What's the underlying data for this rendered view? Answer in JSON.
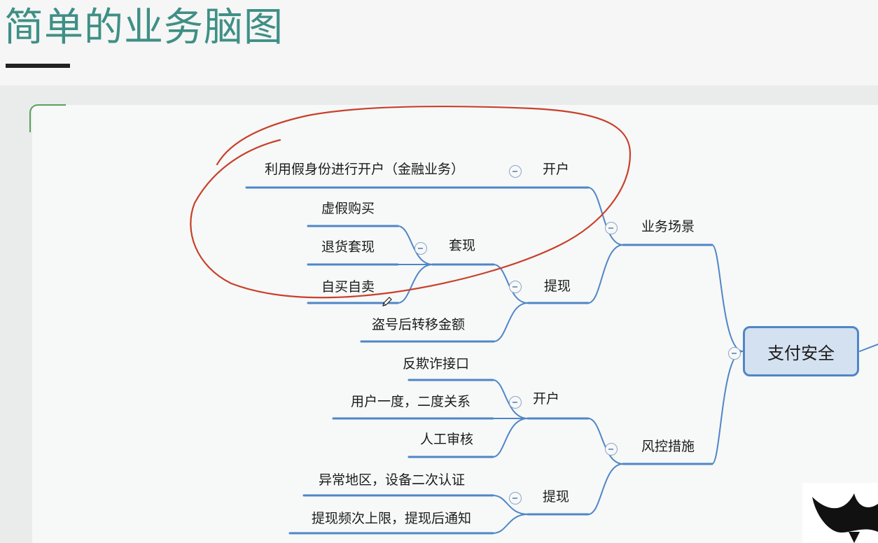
{
  "slide_title": "简单的业务脑图",
  "mind_map": {
    "root": "支付安全",
    "branch_business": {
      "label": "业务场景",
      "open_account": {
        "label": "开户",
        "items": [
          "利用假身份进行开户（金融业务）"
        ]
      },
      "withdraw": {
        "label": "提现",
        "cashout": {
          "label": "套现",
          "items": [
            "虚假购买",
            "退货套现",
            "自买自卖"
          ]
        },
        "items": [
          "盗号后转移金额"
        ]
      }
    },
    "branch_risk": {
      "label": "风控措施",
      "open_account": {
        "label": "开户",
        "items": [
          "反欺诈接口",
          "用户一度，二度关系",
          "人工审核"
        ]
      },
      "withdraw": {
        "label": "提现",
        "items": [
          "异常地区，设备二次认证",
          "提现频次上限，提现后通知"
        ]
      }
    }
  },
  "colors": {
    "title": "#3f8f86",
    "line": "#4f86c6",
    "annotation": "#c8402a"
  },
  "icons": [
    "collapse-icon",
    "pencil-cursor-icon"
  ]
}
